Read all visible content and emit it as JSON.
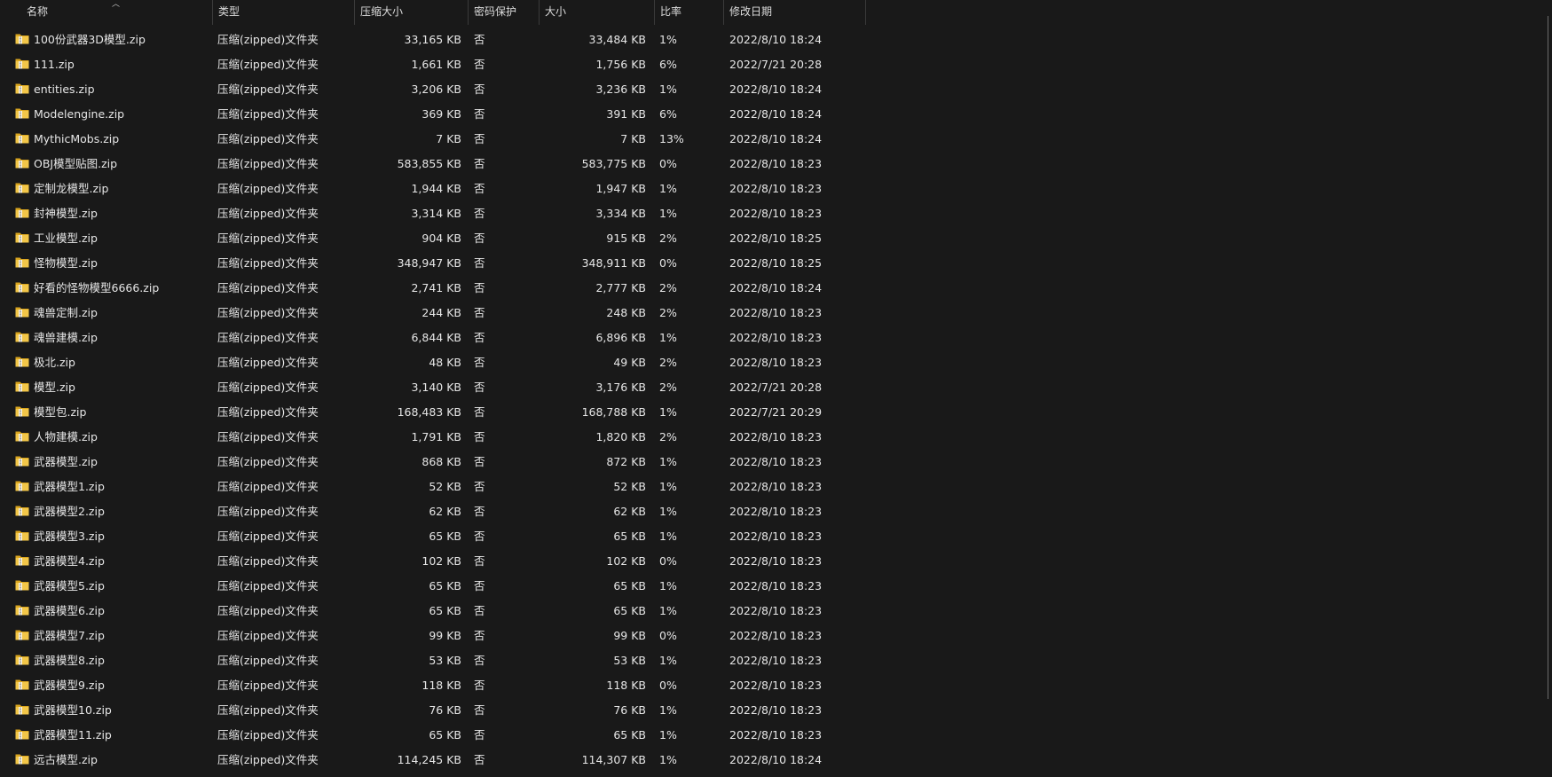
{
  "headers": {
    "name": "名称",
    "type": "类型",
    "compressed_size": "压缩大小",
    "password": "密码保护",
    "size": "大小",
    "ratio": "比率",
    "modified": "修改日期"
  },
  "icon": "zip-folder-icon",
  "rows": [
    {
      "name": "100份武器3D模型.zip",
      "type": "压缩(zipped)文件夹",
      "csize": "33,165 KB",
      "pwd": "否",
      "size": "33,484 KB",
      "ratio": "1%",
      "date": "2022/8/10 18:24"
    },
    {
      "name": "111.zip",
      "type": "压缩(zipped)文件夹",
      "csize": "1,661 KB",
      "pwd": "否",
      "size": "1,756 KB",
      "ratio": "6%",
      "date": "2022/7/21 20:28"
    },
    {
      "name": "entities.zip",
      "type": "压缩(zipped)文件夹",
      "csize": "3,206 KB",
      "pwd": "否",
      "size": "3,236 KB",
      "ratio": "1%",
      "date": "2022/8/10 18:24"
    },
    {
      "name": "Modelengine.zip",
      "type": "压缩(zipped)文件夹",
      "csize": "369 KB",
      "pwd": "否",
      "size": "391 KB",
      "ratio": "6%",
      "date": "2022/8/10 18:24"
    },
    {
      "name": "MythicMobs.zip",
      "type": "压缩(zipped)文件夹",
      "csize": "7 KB",
      "pwd": "否",
      "size": "7 KB",
      "ratio": "13%",
      "date": "2022/8/10 18:24"
    },
    {
      "name": "OBJ模型贴图.zip",
      "type": "压缩(zipped)文件夹",
      "csize": "583,855 KB",
      "pwd": "否",
      "size": "583,775 KB",
      "ratio": "0%",
      "date": "2022/8/10 18:23"
    },
    {
      "name": "定制龙模型.zip",
      "type": "压缩(zipped)文件夹",
      "csize": "1,944 KB",
      "pwd": "否",
      "size": "1,947 KB",
      "ratio": "1%",
      "date": "2022/8/10 18:23"
    },
    {
      "name": "封神模型.zip",
      "type": "压缩(zipped)文件夹",
      "csize": "3,314 KB",
      "pwd": "否",
      "size": "3,334 KB",
      "ratio": "1%",
      "date": "2022/8/10 18:23"
    },
    {
      "name": "工业模型.zip",
      "type": "压缩(zipped)文件夹",
      "csize": "904 KB",
      "pwd": "否",
      "size": "915 KB",
      "ratio": "2%",
      "date": "2022/8/10 18:25"
    },
    {
      "name": "怪物模型.zip",
      "type": "压缩(zipped)文件夹",
      "csize": "348,947 KB",
      "pwd": "否",
      "size": "348,911 KB",
      "ratio": "0%",
      "date": "2022/8/10 18:25"
    },
    {
      "name": "好看的怪物模型6666.zip",
      "type": "压缩(zipped)文件夹",
      "csize": "2,741 KB",
      "pwd": "否",
      "size": "2,777 KB",
      "ratio": "2%",
      "date": "2022/8/10 18:24"
    },
    {
      "name": "魂兽定制.zip",
      "type": "压缩(zipped)文件夹",
      "csize": "244 KB",
      "pwd": "否",
      "size": "248 KB",
      "ratio": "2%",
      "date": "2022/8/10 18:23"
    },
    {
      "name": "魂兽建模.zip",
      "type": "压缩(zipped)文件夹",
      "csize": "6,844 KB",
      "pwd": "否",
      "size": "6,896 KB",
      "ratio": "1%",
      "date": "2022/8/10 18:23"
    },
    {
      "name": "极北.zip",
      "type": "压缩(zipped)文件夹",
      "csize": "48 KB",
      "pwd": "否",
      "size": "49 KB",
      "ratio": "2%",
      "date": "2022/8/10 18:23"
    },
    {
      "name": "模型.zip",
      "type": "压缩(zipped)文件夹",
      "csize": "3,140 KB",
      "pwd": "否",
      "size": "3,176 KB",
      "ratio": "2%",
      "date": "2022/7/21 20:28"
    },
    {
      "name": "模型包.zip",
      "type": "压缩(zipped)文件夹",
      "csize": "168,483 KB",
      "pwd": "否",
      "size": "168,788 KB",
      "ratio": "1%",
      "date": "2022/7/21 20:29"
    },
    {
      "name": "人物建模.zip",
      "type": "压缩(zipped)文件夹",
      "csize": "1,791 KB",
      "pwd": "否",
      "size": "1,820 KB",
      "ratio": "2%",
      "date": "2022/8/10 18:23"
    },
    {
      "name": "武器模型.zip",
      "type": "压缩(zipped)文件夹",
      "csize": "868 KB",
      "pwd": "否",
      "size": "872 KB",
      "ratio": "1%",
      "date": "2022/8/10 18:23"
    },
    {
      "name": "武器模型1.zip",
      "type": "压缩(zipped)文件夹",
      "csize": "52 KB",
      "pwd": "否",
      "size": "52 KB",
      "ratio": "1%",
      "date": "2022/8/10 18:23"
    },
    {
      "name": "武器模型2.zip",
      "type": "压缩(zipped)文件夹",
      "csize": "62 KB",
      "pwd": "否",
      "size": "62 KB",
      "ratio": "1%",
      "date": "2022/8/10 18:23"
    },
    {
      "name": "武器模型3.zip",
      "type": "压缩(zipped)文件夹",
      "csize": "65 KB",
      "pwd": "否",
      "size": "65 KB",
      "ratio": "1%",
      "date": "2022/8/10 18:23"
    },
    {
      "name": "武器模型4.zip",
      "type": "压缩(zipped)文件夹",
      "csize": "102 KB",
      "pwd": "否",
      "size": "102 KB",
      "ratio": "0%",
      "date": "2022/8/10 18:23"
    },
    {
      "name": "武器模型5.zip",
      "type": "压缩(zipped)文件夹",
      "csize": "65 KB",
      "pwd": "否",
      "size": "65 KB",
      "ratio": "1%",
      "date": "2022/8/10 18:23"
    },
    {
      "name": "武器模型6.zip",
      "type": "压缩(zipped)文件夹",
      "csize": "65 KB",
      "pwd": "否",
      "size": "65 KB",
      "ratio": "1%",
      "date": "2022/8/10 18:23"
    },
    {
      "name": "武器模型7.zip",
      "type": "压缩(zipped)文件夹",
      "csize": "99 KB",
      "pwd": "否",
      "size": "99 KB",
      "ratio": "0%",
      "date": "2022/8/10 18:23"
    },
    {
      "name": "武器模型8.zip",
      "type": "压缩(zipped)文件夹",
      "csize": "53 KB",
      "pwd": "否",
      "size": "53 KB",
      "ratio": "1%",
      "date": "2022/8/10 18:23"
    },
    {
      "name": "武器模型9.zip",
      "type": "压缩(zipped)文件夹",
      "csize": "118 KB",
      "pwd": "否",
      "size": "118 KB",
      "ratio": "0%",
      "date": "2022/8/10 18:23"
    },
    {
      "name": "武器模型10.zip",
      "type": "压缩(zipped)文件夹",
      "csize": "76 KB",
      "pwd": "否",
      "size": "76 KB",
      "ratio": "1%",
      "date": "2022/8/10 18:23"
    },
    {
      "name": "武器模型11.zip",
      "type": "压缩(zipped)文件夹",
      "csize": "65 KB",
      "pwd": "否",
      "size": "65 KB",
      "ratio": "1%",
      "date": "2022/8/10 18:23"
    },
    {
      "name": "远古模型.zip",
      "type": "压缩(zipped)文件夹",
      "csize": "114,245 KB",
      "pwd": "否",
      "size": "114,307 KB",
      "ratio": "1%",
      "date": "2022/8/10 18:24"
    }
  ]
}
